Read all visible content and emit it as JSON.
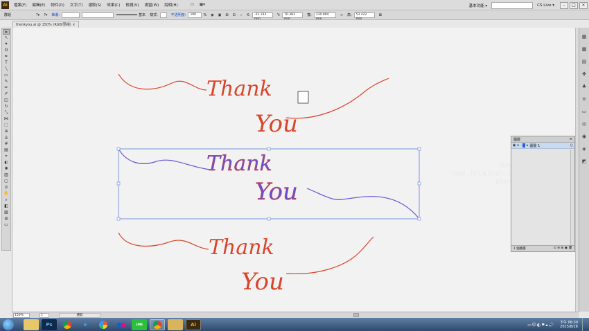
{
  "app": {
    "logo": "Ai"
  },
  "menu": {
    "items": [
      "檔案(F)",
      "編輯(E)",
      "物件(O)",
      "文字(T)",
      "選取(S)",
      "效果(C)",
      "檢視(V)",
      "視窗(W)",
      "說明(H)"
    ]
  },
  "topright": {
    "workspace": "基本功能 ▾",
    "cs_live": "CS Live ▾"
  },
  "control": {
    "selection": "群組",
    "stroke_label": "筆畫:",
    "brush": "基本",
    "style_label": "樣式:",
    "opacity_label": "不透明度:",
    "opacity_value": "100",
    "opacity_unit": "%",
    "x_label": "X:",
    "x_value": "-22.313 mm",
    "y_label": "Y:",
    "y_value": "70.383 mm",
    "w_label": "寬:",
    "w_value": "230.894 mm",
    "h_label": "高:",
    "h_value": "53.422 mm"
  },
  "document": {
    "tab": "thenkyou.ai @ 150% (RGB/預視)"
  },
  "artwork": {
    "top": [
      "Thank",
      "You"
    ],
    "selected": [
      "Thank",
      "You"
    ],
    "bottom": [
      "Thank",
      "You"
    ],
    "ink_color": "#d9452a",
    "selected_color": "#6a4fd0",
    "selection_color": "#5a7fd8"
  },
  "layers_panel": {
    "title": "圖層",
    "layer_name": "圖層 1",
    "count": "1 個圖層"
  },
  "status": {
    "zoom": "150%",
    "page": "1",
    "text": "選取"
  },
  "watermark": {
    "line1": "www.smallwen.com",
    "line2": "www.facebook.com/smallwen53",
    "line3": "photo by Evelyn ®"
  },
  "taskbar": {
    "apps": [
      {
        "name": "Explorer",
        "icon": "folder-icon"
      },
      {
        "name": "Photoshop",
        "icon": "ps-icon",
        "label": "Ps"
      },
      {
        "name": "Chrome",
        "icon": "chrome-icon"
      },
      {
        "name": "Internet Explorer",
        "icon": "ie-icon",
        "label": "e"
      },
      {
        "name": "Picasa",
        "icon": "picasa-icon"
      },
      {
        "name": "Flickr",
        "icon": "flickr-icon"
      },
      {
        "name": "LINE",
        "icon": "line-icon",
        "label": "LINE"
      },
      {
        "name": "Chrome",
        "icon": "chrome-icon"
      },
      {
        "name": "Files",
        "icon": "files-icon"
      },
      {
        "name": "Illustrator",
        "icon": "ai-icon",
        "label": "Ai"
      }
    ],
    "clock_time": "下午 06:30",
    "clock_date": "2015/8/28"
  }
}
